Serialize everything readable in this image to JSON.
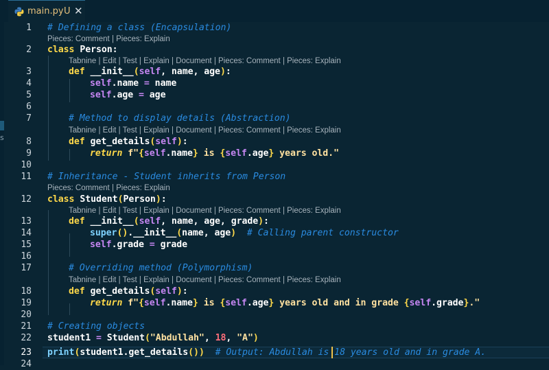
{
  "tab": {
    "filename": "main.py",
    "modified": "U",
    "close": "✕"
  },
  "sidebar": {
    "glyph": "s"
  },
  "line_numbers": [
    "1",
    "2",
    "3",
    "4",
    "5",
    "6",
    "7",
    "8",
    "9",
    "10",
    "11",
    "12",
    "13",
    "14",
    "15",
    "16",
    "17",
    "18",
    "19",
    "20",
    "21",
    "22",
    "23",
    "24"
  ],
  "codelens": {
    "pieces": "Pieces: Comment | Pieces: Explain",
    "tabnine": "Tabnine | Edit | Test | Explain | Document | Pieces: Comment | Pieces: Explain"
  },
  "code": {
    "l1": "# Defining a class (Encapsulation)",
    "l2": {
      "kw": "class",
      "name": " Person:"
    },
    "l3": {
      "kw": "def",
      "fn": " __init__",
      "p1": "(",
      "self": "self",
      "rest": ", name, age",
      "p2": ")",
      "colon": ":"
    },
    "l4": {
      "self": "self",
      "attr": ".name ",
      "op": "=",
      "rest": " name"
    },
    "l5": {
      "self": "self",
      "attr": ".age ",
      "op": "=",
      "rest": " age"
    },
    "l7": "# Method to display details (Abstraction)",
    "l8": {
      "kw": "def",
      "fn": " get_details",
      "p1": "(",
      "self": "self",
      "p2": ")",
      "colon": ":"
    },
    "l9": {
      "kw": "return",
      "pre": " f\"",
      "b1": "{",
      "s1": "self",
      "a1": ".name",
      "b2": "}",
      "m1": " is ",
      "b3": "{",
      "s2": "self",
      "a2": ".age",
      "b4": "}",
      "m2": " years old.\""
    },
    "l11": "# Inheritance - Student inherits from Person",
    "l12": {
      "kw": "class",
      "name": " Student",
      "p1": "(",
      "base": "Person",
      "p2": ")",
      "colon": ":"
    },
    "l13": {
      "kw": "def",
      "fn": " __init__",
      "p1": "(",
      "self": "self",
      "rest": ", name, age, grade",
      "p2": ")",
      "colon": ":"
    },
    "l14": {
      "super": "super",
      "p": "()",
      "init": ".__init__",
      "p1": "(",
      "args": "name, age",
      "p2": ")",
      "cm": "  # Calling parent constructor"
    },
    "l15": {
      "self": "self",
      "attr": ".grade ",
      "op": "=",
      "rest": " grade"
    },
    "l17": "# Overriding method (Polymorphism)",
    "l18": {
      "kw": "def",
      "fn": " get_details",
      "p1": "(",
      "self": "self",
      "p2": ")",
      "colon": ":"
    },
    "l19": {
      "kw": "return",
      "pre": " f\"",
      "b1": "{",
      "s1": "self",
      "a1": ".name",
      "b2": "}",
      "m1": " is ",
      "b3": "{",
      "s2": "self",
      "a2": ".age",
      "b4": "}",
      "m2": " years old and in grade ",
      "b5": "{",
      "s3": "self",
      "a3": ".grade",
      "b6": "}",
      "m3": ".\""
    },
    "l21": "# Creating objects",
    "l22": {
      "var": "student1 ",
      "op": "=",
      "cls": " Student",
      "p1": "(",
      "str1": "\"Abdullah\"",
      "c1": ", ",
      "num": "18",
      "c2": ", ",
      "str2": "\"A\"",
      "p2": ")"
    },
    "l23": {
      "print": "print",
      "p1": "(",
      "obj": "student1",
      "meth": ".get_details",
      "p3": "()",
      "p2": ")",
      "cm": "  # Output: Abdullah is 18 years old and in grade A."
    }
  },
  "colors": {
    "background": "#0a2533",
    "comment": "#2a8be0",
    "keyword": "#ffd94a",
    "self": "#c586f2",
    "string": "#ffe1a0",
    "number": "#ff6e7a"
  }
}
